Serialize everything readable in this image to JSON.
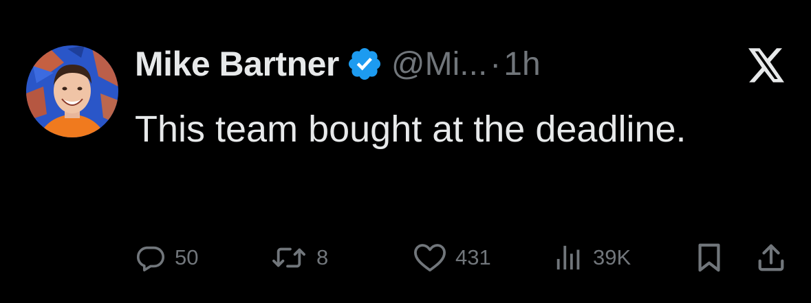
{
  "author": {
    "name": "Mike Bartner",
    "handle": "@Mi...",
    "separator": "·",
    "time": "1h",
    "verified_color": "#1d9bf0"
  },
  "tweet": {
    "text": "This team bought at the deadline."
  },
  "actions": {
    "replies": "50",
    "retweets": "8",
    "likes": "431",
    "views": "39K"
  },
  "icons": {
    "reply": "reply-icon",
    "retweet": "retweet-icon",
    "like": "heart-icon",
    "views": "views-icon",
    "bookmark": "bookmark-icon",
    "share": "share-icon",
    "platform": "x-logo-icon"
  },
  "colors": {
    "background": "#000000",
    "text_primary": "#e7e9ea",
    "text_secondary": "#71767b",
    "accent": "#1d9bf0"
  }
}
